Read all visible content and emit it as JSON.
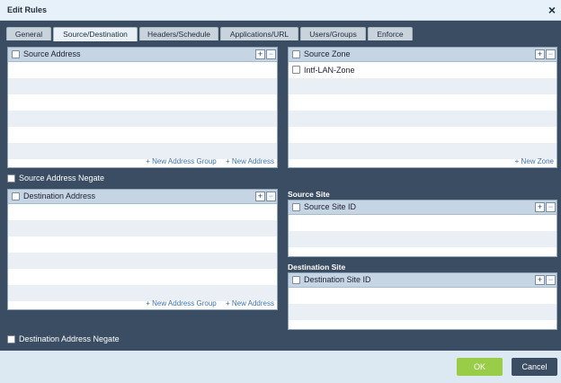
{
  "dialog": {
    "title": "Edit Rules"
  },
  "tabs": [
    "General",
    "Source/Destination",
    "Headers/Schedule",
    "Applications/URL",
    "Users/Groups",
    "Enforce"
  ],
  "source_address": {
    "header": "Source Address",
    "new_group": "+ New Address Group",
    "new_address": "+ New Address"
  },
  "source_address_negate": "Source Address Negate",
  "destination_address": {
    "header": "Destination Address",
    "new_group": "+ New Address Group",
    "new_address": "+ New Address"
  },
  "destination_address_negate": "Destination Address Negate",
  "source_zone": {
    "header": "Source Zone",
    "items": [
      "Intf-LAN-Zone"
    ],
    "new_zone": "+ New Zone"
  },
  "source_site": {
    "title": "Source Site",
    "header": "Source Site ID"
  },
  "destination_site": {
    "title": "Destination Site",
    "header": "Destination Site ID"
  },
  "buttons": {
    "ok": "OK",
    "cancel": "Cancel"
  },
  "colors": {
    "body_bg": "#3a4d63",
    "ok": "#9acd47",
    "cancel": "#3a4d63",
    "link": "#3e71a8"
  },
  "icons": {
    "add": "plus-icon",
    "remove": "minus-icon",
    "close": "close-icon"
  }
}
